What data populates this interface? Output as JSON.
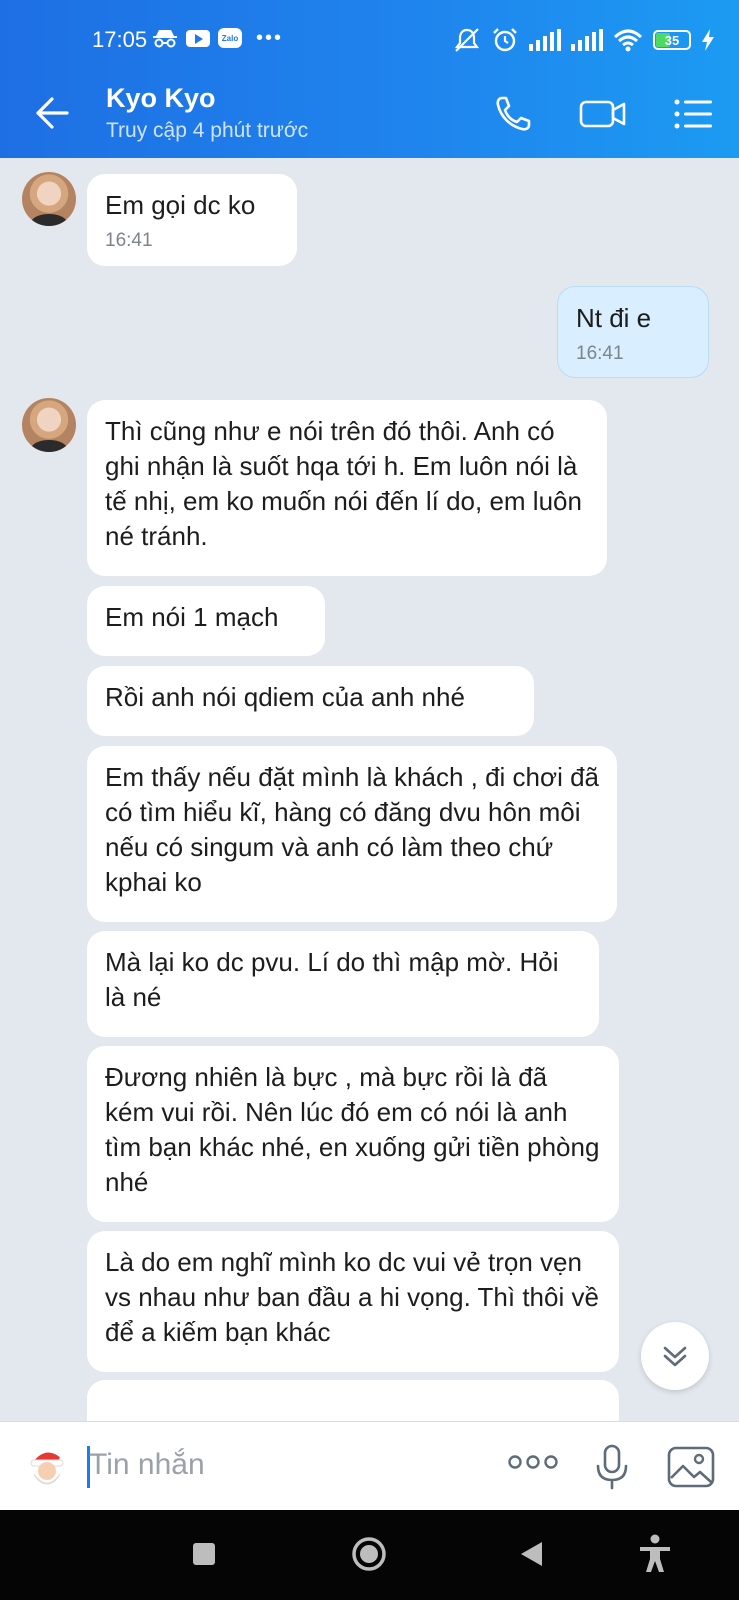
{
  "status_bar": {
    "time": "17:05",
    "zalo_badge": "Zalo",
    "battery": "35"
  },
  "header": {
    "name": "Kyo Kyo",
    "status": "Truy cập 4 phút trước"
  },
  "messages": [
    {
      "dir": "in",
      "text": "Em gọi dc ko",
      "time": "16:41"
    },
    {
      "dir": "out",
      "text": "Nt đi e",
      "time": "16:41"
    },
    {
      "dir": "in",
      "text": "Thì cũng như e nói trên đó thôi. Anh có ghi nhận là suốt hqa tới h. Em luôn nói là tế nhị,  em ko muốn nói đến lí do,  em luôn né tránh."
    },
    {
      "dir": "in",
      "text": "Em nói 1 mạch"
    },
    {
      "dir": "in",
      "text": "Rồi anh nói qdiem của anh nhé"
    },
    {
      "dir": "in",
      "text": "Em thấy nếu đặt mình là khách ,  đi chơi đã có tìm hiểu kĩ,  hàng có đăng dvu hôn môi nếu có singum và anh có làm theo chứ kphai ko"
    },
    {
      "dir": "in",
      "text": "Mà lại ko dc pvu. Lí do thì mập mờ. Hỏi là né"
    },
    {
      "dir": "in",
      "text": "Đương nhiên là bực ,  mà bực rồi là đã kém vui rồi.  Nên lúc đó em có nói là anh tìm bạn khác nhé,  en xuống gửi tiền phòng nhé"
    },
    {
      "dir": "in",
      "text": "Là do em nghĩ mình ko dc vui vẻ trọn vẹn vs nhau như ban đầu a hi vọng. Thì thôi về để a kiếm bạn khác"
    }
  ],
  "input": {
    "placeholder": "Tin nhắn"
  },
  "colors": {
    "header_gradient_start": "#1e6fe3",
    "header_gradient_end": "#1c9bf2",
    "chat_background": "#e3e8ef",
    "incoming_bubble": "#ffffff",
    "outgoing_bubble": "#d9eefe",
    "accent": "#1a7cf0"
  },
  "icons": {
    "status_left": [
      "incognito-icon",
      "youtube-icon",
      "zalo-icon",
      "more-notifications-icon"
    ],
    "status_right": [
      "silent-icon",
      "alarm-icon",
      "signal-icon",
      "signal-icon",
      "wifi-icon",
      "battery-icon",
      "charging-icon"
    ],
    "header": [
      "back-arrow-icon",
      "phone-icon",
      "video-call-icon",
      "menu-list-icon"
    ],
    "input": [
      "sticker-icon",
      "more-icon",
      "mic-icon",
      "gallery-icon"
    ],
    "nav": [
      "recents-icon",
      "home-icon",
      "back-icon",
      "accessibility-icon"
    ]
  }
}
